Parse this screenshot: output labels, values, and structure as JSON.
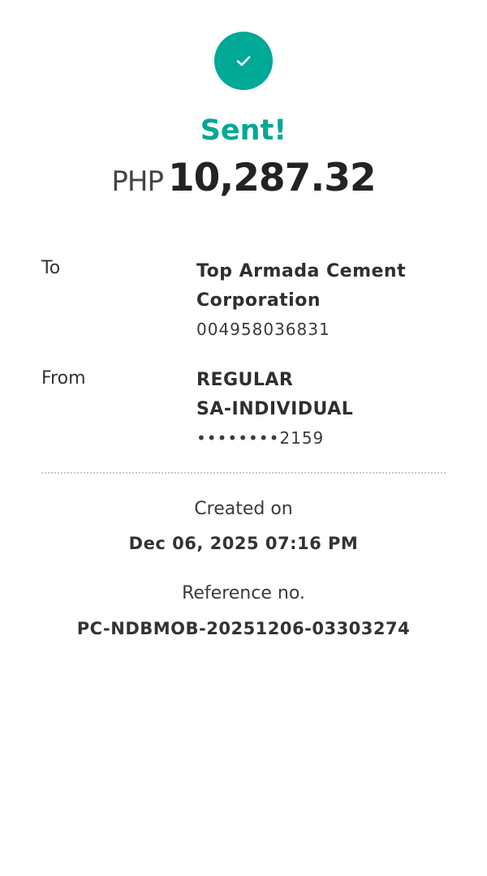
{
  "theme": {
    "accent": "#00a896"
  },
  "status": {
    "icon": "check-icon",
    "title": "Sent!"
  },
  "amount": {
    "currency": "PHP",
    "value": "10,287.32"
  },
  "details": {
    "to": {
      "label": "To",
      "name_line1": "Top Armada Cement",
      "name_line2": "Corporation",
      "account": "004958036831"
    },
    "from": {
      "label": "From",
      "name_line1": "REGULAR",
      "name_line2": "SA-INDIVIDUAL",
      "account": "••••••••2159"
    }
  },
  "meta": {
    "created_label": "Created on",
    "created_value": "Dec 06, 2025 07:16 PM",
    "reference_label": "Reference no.",
    "reference_value": "PC-NDBMOB-20251206-03303274"
  }
}
